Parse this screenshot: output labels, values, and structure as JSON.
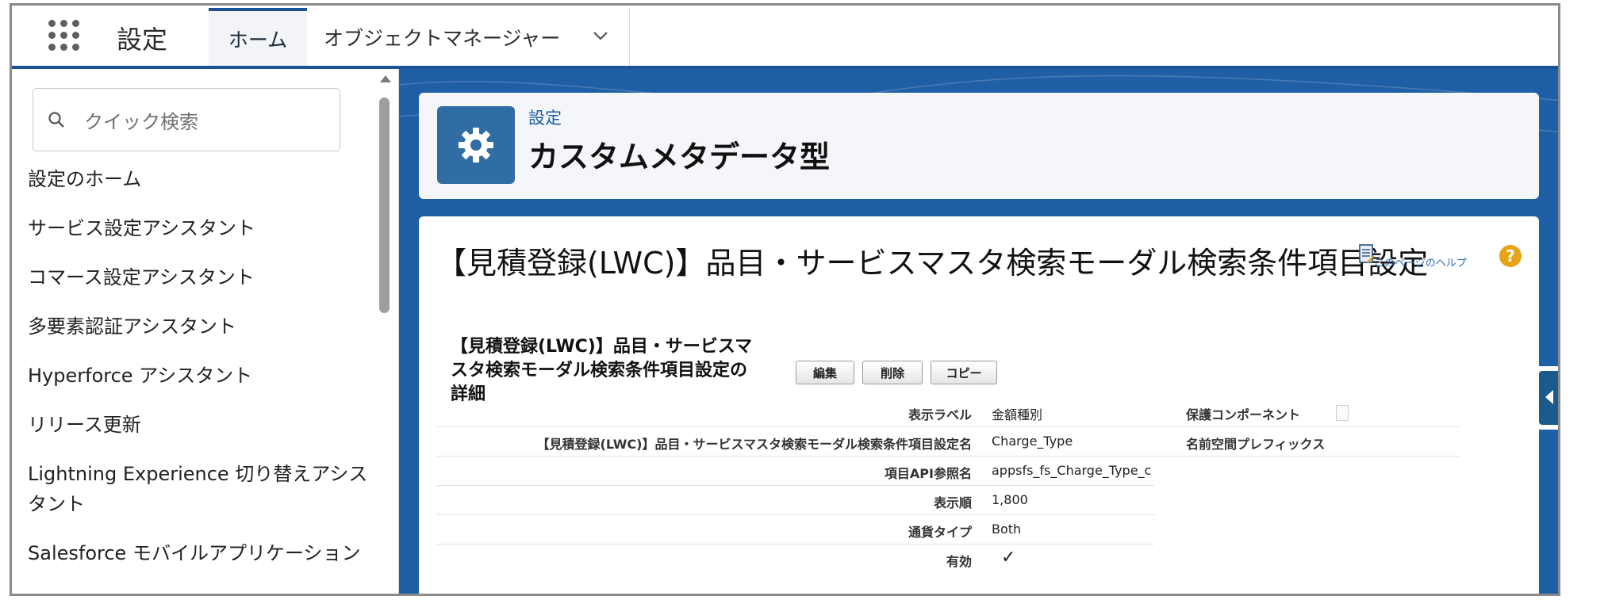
{
  "topnav": {
    "app_name": "設定",
    "tabs": [
      {
        "label": "ホーム"
      },
      {
        "label": "オブジェクトマネージャー"
      }
    ]
  },
  "sidebar": {
    "search_placeholder": "クイック検索",
    "items": [
      {
        "label": "設定のホーム"
      },
      {
        "label": "サービス設定アシスタント"
      },
      {
        "label": "コマース設定アシスタント"
      },
      {
        "label": "多要素認証アシスタント"
      },
      {
        "label": "Hyperforce アシスタント"
      },
      {
        "label": "リリース更新"
      },
      {
        "label": "Lightning Experience 切り替えアシスタント"
      },
      {
        "label": "Salesforce モバイルアプリケーション"
      }
    ]
  },
  "header": {
    "label": "設定",
    "title": "カスタムメタデータ型",
    "icon": "gear-icon"
  },
  "page": {
    "title": "【見積登録(LWC)】品目・サービスマスタ検索モーダル検索条件項目設定",
    "help_link": "このページのヘルプ",
    "help_icon": "?"
  },
  "detail": {
    "title": "【見積登録(LWC)】品目・サービスマスタ検索モーダル検索条件項目設定の詳細",
    "buttons": {
      "edit": "編集",
      "delete": "削除",
      "copy": "コピー"
    },
    "fields": [
      {
        "label": "表示ラベル",
        "value": "金額種別"
      },
      {
        "label": "【見積登録(LWC)】品目・サービスマスタ検索モーダル検索条件項目設定名",
        "value": "Charge_Type"
      },
      {
        "label": "項目API参照名",
        "value": "appsfs_fs_Charge_Type_c"
      },
      {
        "label": "表示順",
        "value": "1,800"
      },
      {
        "label": "通貨タイプ",
        "value": "Both"
      },
      {
        "label": "有効",
        "value": "✓"
      }
    ],
    "right_fields": [
      {
        "label": "保護コンポーネント",
        "value": ""
      },
      {
        "label": "名前空間プレフィックス",
        "value": ""
      }
    ]
  },
  "colors": {
    "brand": "#1b5297",
    "main_bg": "#1f5fa6",
    "icon_bg": "#2f6da4",
    "help": "#e8a317"
  }
}
